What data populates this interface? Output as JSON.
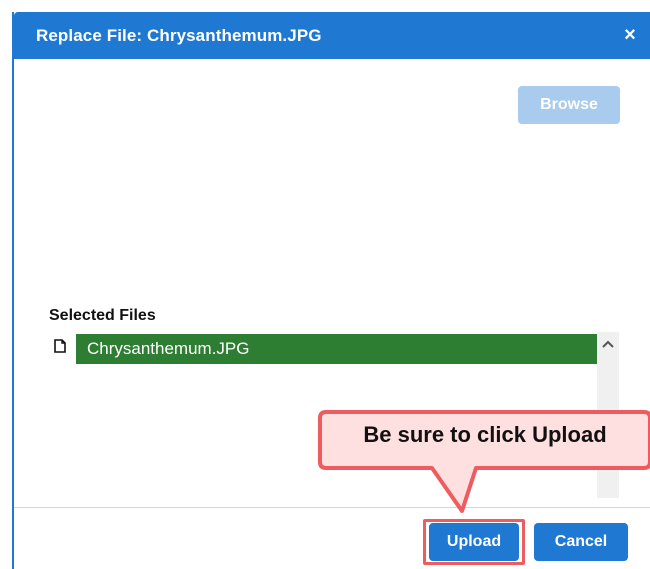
{
  "dialog": {
    "title": "Replace File: Chrysanthemum.JPG",
    "close_icon": "close-icon",
    "close_symbol": "×",
    "browse_label": "Browse",
    "selected_files_label": "Selected Files",
    "selected_files": [
      {
        "name": "Chrysanthemum.JPG",
        "icon": "file-icon"
      }
    ],
    "upload_label": "Upload",
    "cancel_label": "Cancel"
  },
  "annotation": {
    "callout_text": "Be sure to click Upload",
    "callout_color": "#ee5c5f",
    "callout_fill": "#ffe0e0"
  },
  "colors": {
    "primary": "#1f78d1",
    "disabled_primary": "#a8cbee",
    "selected_file": "#2d7d32",
    "highlight": "#ee5c5f"
  }
}
